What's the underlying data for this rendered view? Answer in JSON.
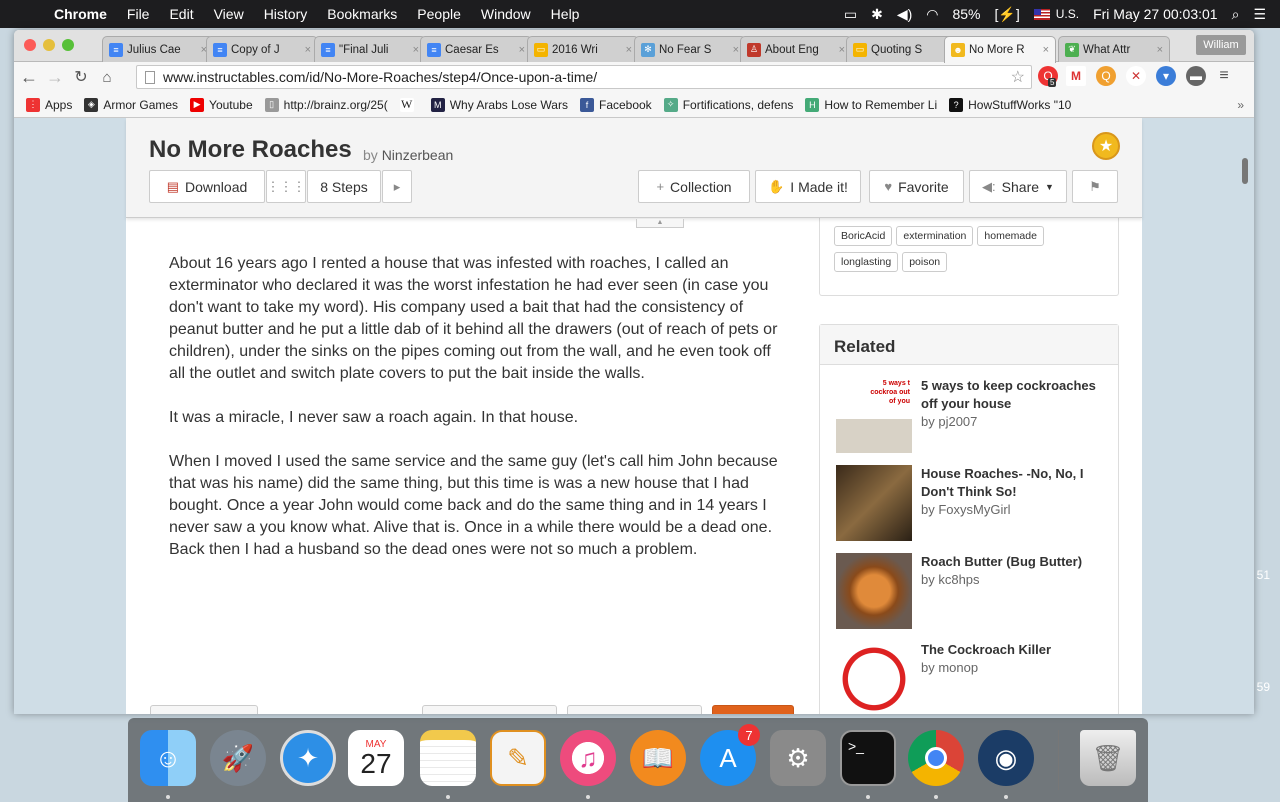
{
  "menubar": {
    "app": "Chrome",
    "items": [
      "File",
      "Edit",
      "View",
      "History",
      "Bookmarks",
      "People",
      "Window",
      "Help"
    ],
    "battery": "85%",
    "input": "U.S.",
    "clock": "Fri May 27  00:03:01"
  },
  "tabs": [
    {
      "label": "Julius Cae",
      "icon": "google-docs-icon",
      "color": "#4285f4"
    },
    {
      "label": "Copy of J",
      "icon": "google-docs-icon",
      "color": "#4285f4"
    },
    {
      "label": "\"Final Juli",
      "icon": "google-docs-icon",
      "color": "#4285f4"
    },
    {
      "label": "Caesar Es",
      "icon": "google-docs-icon",
      "color": "#4285f4"
    },
    {
      "label": "2016 Wri",
      "icon": "google-slides-icon",
      "color": "#f4b400"
    },
    {
      "label": "No Fear S",
      "icon": "snowflake-icon",
      "color": "#5aa0d8"
    },
    {
      "label": "About Eng",
      "icon": "person-icon",
      "color": "#c0392b"
    },
    {
      "label": "Quoting S",
      "icon": "google-slides-icon",
      "color": "#f4b400"
    },
    {
      "label": "No More R",
      "icon": "instructables-robot-icon",
      "color": "#f1b91e"
    },
    {
      "label": "What Attr",
      "icon": "leaf-icon",
      "color": "#4caf50"
    }
  ],
  "active_tab": 8,
  "user": "William",
  "url": "www.instructables.com/id/No-More-Roaches/step4/Once-upon-a-time/",
  "extensions_badge": "5",
  "bookmarks": [
    {
      "label": "Apps",
      "icon": "apps-grid-icon"
    },
    {
      "label": "Armor Games",
      "icon": "shield-icon"
    },
    {
      "label": "Youtube",
      "icon": "youtube-icon"
    },
    {
      "label": "http://brainz.org/25(",
      "icon": "page-icon"
    },
    {
      "label": "",
      "icon": "wikipedia-icon"
    },
    {
      "label": "Why Arabs Lose Wars",
      "icon": "mef-icon"
    },
    {
      "label": "Facebook",
      "icon": "facebook-icon"
    },
    {
      "label": "Fortifications, defens",
      "icon": "star-compass-icon"
    },
    {
      "label": "How to Remember Li",
      "icon": "h-icon"
    },
    {
      "label": "HowStuffWorks \"10",
      "icon": "question-icon"
    }
  ],
  "page": {
    "title": "No More Roaches",
    "by_prefix": "by",
    "author": "Ninzerbean",
    "download": "Download",
    "steps": "8 Steps",
    "collection": "Collection",
    "made_it": "I Made it!",
    "favorite": "Favorite",
    "share": "Share",
    "paragraphs": [
      "About 16 years ago I rented a house that was infested with roaches, I called an exterminator who declared it was the worst infestation he had ever seen (in case you don't want to take my word). His company used a bait that had the consistency of peanut butter and he put a little dab of it behind all the drawers (out of reach of pets or children), under the sinks on the pipes coming out from the wall, and he even took off all the outlet and switch plate covers to put the bait inside the walls.",
      "It was a miracle, I never saw a roach again. In that house.",
      "When I moved I used the same service and the same guy (let's call him John because that was his name) did the same thing, but this time is was a new house that I had bought. Once a year John would come back and do the same thing and in 14 years I never saw a you know what. Alive that is. Once in a while there would be a dead one. Back then I had a husband so the dead ones were not so much a problem."
    ],
    "tags": [
      "BoricAcid",
      "extermination",
      "homemade",
      "longlasting",
      "poison"
    ],
    "related_title": "Related",
    "related": [
      {
        "title": "5 ways to keep cockroaches off your house",
        "author": "by pj2007",
        "thumb_text": "5 ways t cockroa out of you"
      },
      {
        "title": "House Roaches- -No, No, I Don't Think So!",
        "author": "by FoxysMyGirl",
        "thumb_text": ""
      },
      {
        "title": "Roach Butter (Bug Butter)",
        "author": "by kc8hps",
        "thumb_text": ""
      },
      {
        "title": "The Cockroach Killer",
        "author": "by monop",
        "thumb_text": ""
      }
    ]
  },
  "dock": {
    "calendar_month": "MAY",
    "calendar_day": "27",
    "appstore_badge": "7",
    "apps": [
      "Finder",
      "Launchpad",
      "Safari",
      "Calendar",
      "Notes",
      "Pages",
      "iTunes",
      "iBooks",
      "App Store",
      "System Preferences",
      "Terminal",
      "Chrome",
      "Steam",
      "Trash"
    ]
  },
  "side_numbers": [
    "51",
    "59"
  ]
}
